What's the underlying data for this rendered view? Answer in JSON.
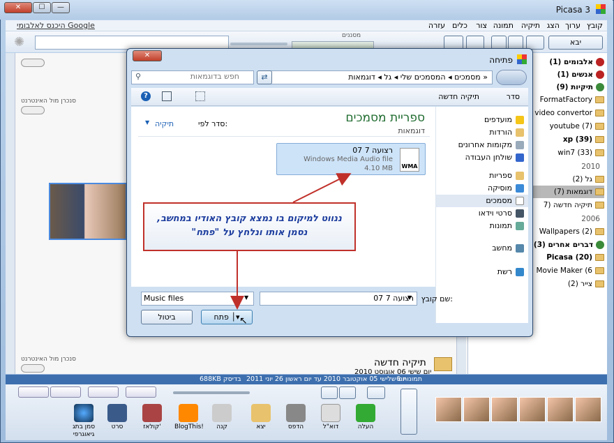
{
  "window": {
    "title": "Picasa 3",
    "min": "—",
    "max": "☐",
    "close": "✕"
  },
  "menu": [
    "קובץ",
    "ערוך",
    "הצג",
    "תיקיה",
    "תמונה",
    "צור",
    "כלים",
    "עזרה"
  ],
  "toolbar": {
    "import": "יבא",
    "google_link": "היכנס לאלבומי Google",
    "filters_label": "מסננים"
  },
  "tree": {
    "headers": [
      {
        "label": "אלבומים (1)"
      },
      {
        "label": "אנשים (1)"
      },
      {
        "label": "תיקיות (9)"
      }
    ],
    "folders": [
      "FormatFactory",
      "video convertor",
      "youtube (7)",
      "xp (39)",
      "win7 (33)"
    ],
    "year2010": "2010",
    "folders2010": [
      "גל (2)",
      "דוגמאות (7)",
      "תיקיה חדשה (7"
    ],
    "year2006": "2006",
    "folders2006": [
      "Wallpapers (2)"
    ],
    "other_header": "דברים אחרים (3)",
    "other": [
      "Picasa (20)",
      "Movie Maker (6",
      "צייר (2)"
    ]
  },
  "left": {
    "sync1": "סנכרן מול האינטרנט",
    "sync2": "סנכרן מול האינטרנט",
    "new_folder": "תיקיה חדשה",
    "new_folder_date": "יום שישי 06 אוגוסט 2010"
  },
  "dialog": {
    "title": "פתיחה",
    "breadcrumb": [
      "«",
      "מסמכים",
      "המסמכים שלי",
      "גל",
      "דוגמאות"
    ],
    "search_placeholder": "חפש בדוגמאות",
    "organize": "סדר",
    "new_folder": "תיקיה חדשה",
    "library_title": "ספריית מסמכים",
    "library_sub": "דוגמאות",
    "sort_label": "סדר לפי:",
    "sort_value": "תיקיה",
    "nav": [
      "מועדפים",
      "הורדות",
      "מקומות אחרונים",
      "שולחן העבודה",
      "ספריות",
      "מוסיקה",
      "מסמכים",
      "סרטי וידאו",
      "תמונות",
      "מחשב",
      "רשת"
    ],
    "file": {
      "name": "רצועה 7 07",
      "type": "Windows Media Audio file",
      "size": "4.10 MB",
      "icon_label": "WMA"
    },
    "filename_label": "שם קובץ:",
    "filename_value": "רצועה 7 07",
    "filetype": "Music files",
    "open": "פתח",
    "cancel": "ביטול"
  },
  "callout": {
    "line1": "ננווט למיקום בו נמצא קובץ האודיו במחשב,",
    "line2": "נסמן אותו ונלחץ על \"פתח\""
  },
  "status": {
    "count": "6 תמונות",
    "dates": "יום שלישי 05 אוקטובר 2010 עד יום ראשון 26 יוני 2011",
    "size": "688KB בדיסק"
  },
  "bottom_tools": [
    "סמן בתג גיאוגרפי",
    "סרט",
    "קולאז'",
    "BlogThis!",
    "קנה",
    "יצא",
    "הדפס",
    "דוא\"ל",
    "העלה"
  ],
  "colors": {
    "accent": "#3d6fae",
    "callout_border": "#c0302a",
    "callout_text": "#1d3d9e"
  }
}
